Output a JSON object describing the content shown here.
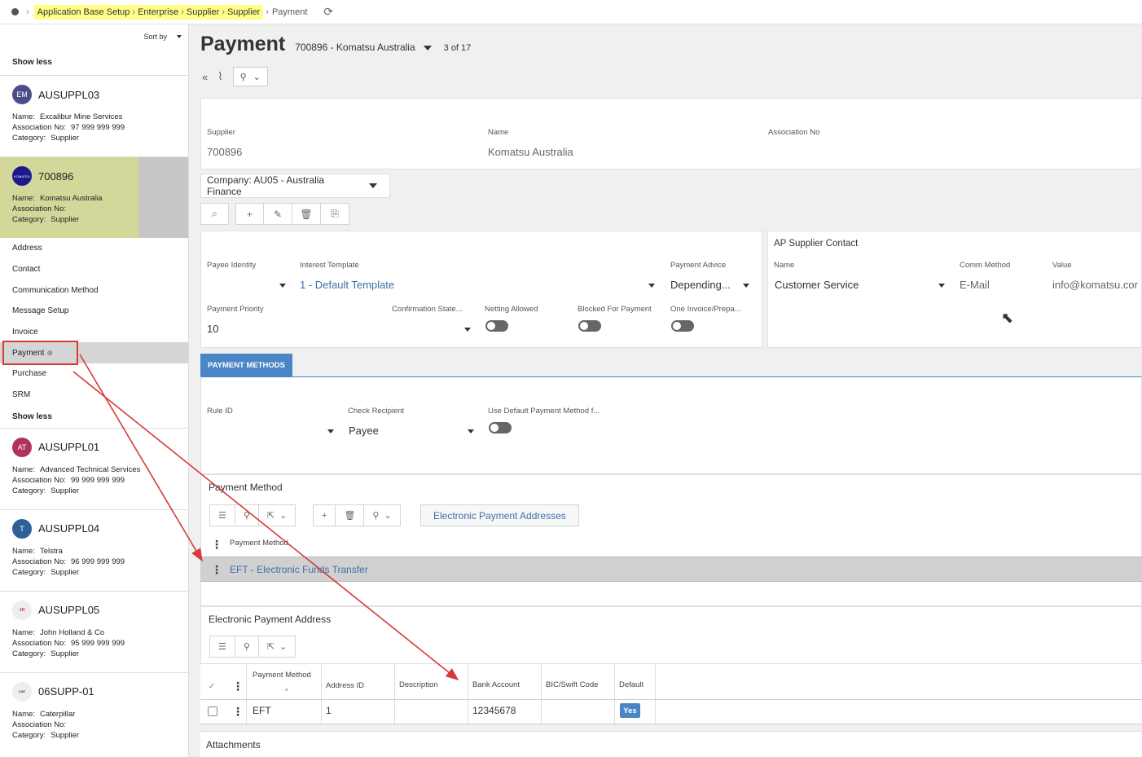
{
  "breadcrumb": {
    "items": [
      "Application Base Setup",
      "Enterprise",
      "Supplier",
      "Supplier"
    ],
    "current": "Payment"
  },
  "sidebar": {
    "sort_label": "Sort by",
    "show_less_top": "Show less",
    "show_less_bottom": "Show less",
    "labels": {
      "name": "Name:",
      "assoc": "Association No:",
      "category": "Category:"
    },
    "records": [
      {
        "initials": "EM",
        "avatar_color": "#4a4d8a",
        "code": "AUSUPPL03",
        "name": "Excalibur Mine Services",
        "assoc": "97 999 999 999",
        "category": "Supplier"
      },
      {
        "initials": "",
        "avatar_color": "#1a1a8e",
        "code": "700896",
        "name": "Komatsu Australia",
        "assoc": "",
        "category": "Supplier"
      },
      {
        "initials": "AT",
        "avatar_color": "#b0345a",
        "code": "AUSUPPL01",
        "name": "Advanced Technical Services",
        "assoc": "99 999 999 999",
        "category": "Supplier"
      },
      {
        "initials": "T",
        "avatar_color": "#2f5f9a",
        "code": "AUSUPPL04",
        "name": "Telstra",
        "assoc": "96 999 999 999",
        "category": "Supplier"
      },
      {
        "initials": "",
        "avatar_color": "#e8e8e8",
        "code": "AUSUPPL05",
        "name": "John Holland & Co",
        "assoc": "95 999 999 999",
        "category": "Supplier"
      },
      {
        "initials": "",
        "avatar_color": "#e8e8e8",
        "code": "06SUPP-01",
        "name": "Caterpillar",
        "assoc": "",
        "category": "Supplier"
      }
    ],
    "nav": [
      "Address",
      "Contact",
      "Communication Method",
      "Message Setup",
      "Invoice",
      "Payment",
      "Purchase",
      "SRM"
    ]
  },
  "header": {
    "title": "Payment",
    "record": "700896 - Komatsu Australia",
    "count": "3 of 17"
  },
  "supplier_card": {
    "supplier_label": "Supplier",
    "supplier_value": "700896",
    "name_label": "Name",
    "name_value": "Komatsu Australia",
    "assoc_label": "Association No",
    "assoc_value": ""
  },
  "company": "Company: AU05 - Australia Finance",
  "payment_card": {
    "payee_identity_label": "Payee Identity",
    "interest_template_label": "Interest Template",
    "interest_template_value": "1 - Default Template",
    "payment_advice_label": "Payment Advice",
    "payment_advice_value": "Depending...",
    "payment_priority_label": "Payment Priority",
    "payment_priority_value": "10",
    "confirmation_label": "Confirmation State...",
    "netting_label": "Netting Allowed",
    "blocked_label": "Blocked For Payment",
    "one_invoice_label": "One Invoice/Prepa..."
  },
  "contact_card": {
    "title": "AP Supplier Contact",
    "name_label": "Name",
    "name_value": "Customer Service",
    "comm_label": "Comm Method",
    "comm_value": "E-Mail",
    "value_label": "Value",
    "value_value": "info@komatsu.cor"
  },
  "payment_methods_tab": "PAYMENT METHODS",
  "pm_form": {
    "rule_label": "Rule ID",
    "check_label": "Check Recipient",
    "check_value": "Payee",
    "use_default_label": "Use Default Payment Method f..."
  },
  "payment_method_section": {
    "title": "Payment Method",
    "epa_button": "Electronic Payment Addresses",
    "column": "Payment Method",
    "row_value": "EFT - Electronic Funds Transfer"
  },
  "epa_section": {
    "title": "Electronic Payment Address",
    "columns": [
      "Payment Method",
      "Address ID",
      "Description",
      "Bank Account",
      "BIC/Swift Code",
      "Default"
    ],
    "row": {
      "payment_method": "EFT",
      "address_id": "1",
      "description": "",
      "bank_account": "12345678",
      "bic": "",
      "default": "Yes"
    }
  },
  "attachments_title": "Attachments",
  "colors": {
    "accent": "#4a86c5",
    "selected": "#d4d79a",
    "annotation": "#d63a3a"
  }
}
